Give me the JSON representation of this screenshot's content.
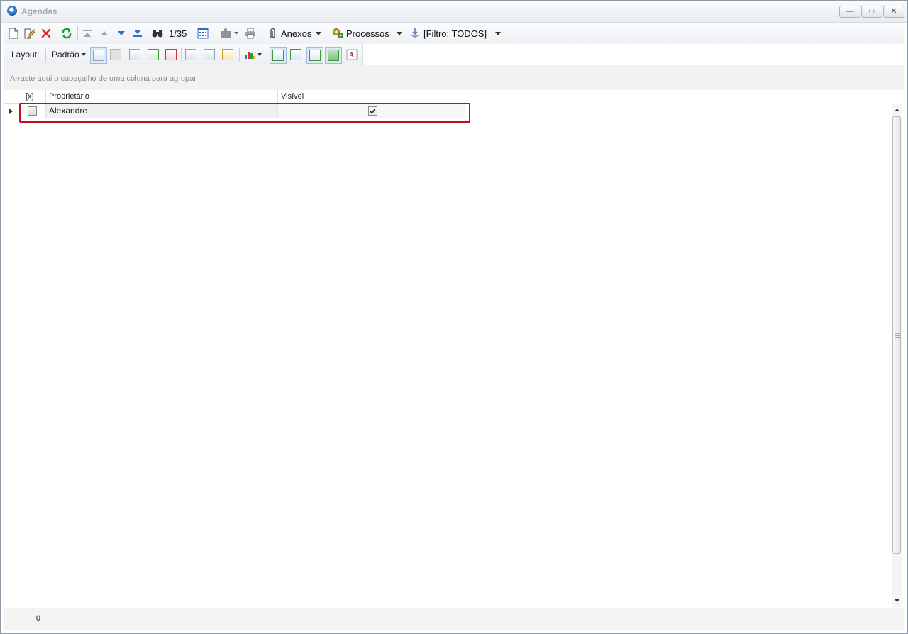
{
  "window": {
    "title": "Agendas",
    "minimize": "—",
    "maximize": "□",
    "close": "✕"
  },
  "toolbar": {
    "record_position": "1/35",
    "anexos_label": "Anexos",
    "processos_label": "Processos",
    "filter_label": "[Filtro: TODOS]"
  },
  "layout_bar": {
    "layout_label": "Layout:",
    "preset_label": "Padrão"
  },
  "group_panel": {
    "hint": "Arraste aqui o cabeçalho de uma coluna para agrupar"
  },
  "grid": {
    "columns": [
      "[x]",
      "Proprietário",
      "Visível"
    ],
    "rows": [
      {
        "selected": false,
        "owner": "Alexandre",
        "visible": true
      }
    ]
  },
  "status": {
    "count": "0"
  },
  "colors": {
    "highlight": "#c0101a",
    "delete": "#d42a2a",
    "refresh": "#1f9d3a"
  }
}
